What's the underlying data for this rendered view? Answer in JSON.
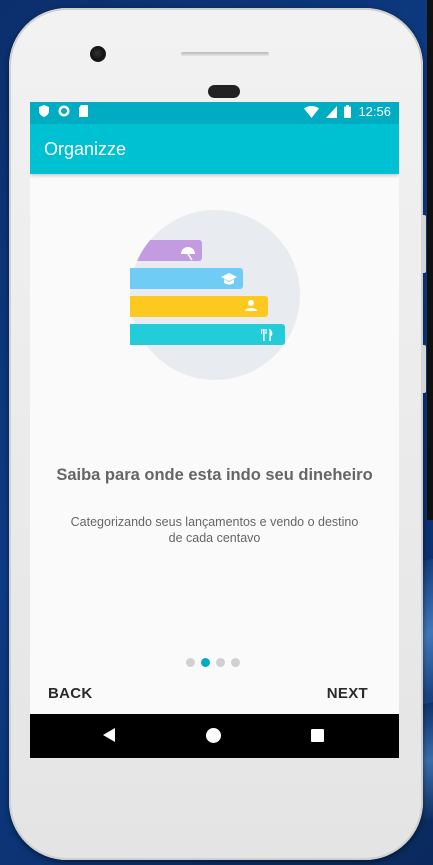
{
  "status_bar": {
    "time": "12:56",
    "icons": [
      "shield-icon",
      "circle-icon",
      "sd-card-icon",
      "wifi-icon",
      "signal-icon",
      "battery-icon"
    ]
  },
  "app_bar": {
    "title": "Organizze"
  },
  "onboarding": {
    "illustration_icons": [
      "umbrella-icon",
      "graduation-cap-icon",
      "person-icon",
      "fork-knife-icon"
    ],
    "colors": {
      "bar_purple": "#c39be0",
      "bar_blue": "#6fcdf5",
      "bar_yellow": "#fcc920",
      "bar_teal": "#22ccd9",
      "circle_bg": "#e8ebf0",
      "accent": "#00acc1"
    },
    "headline": "Saiba para onde esta indo seu dineheiro",
    "subtitle": "Categorizando seus lançamentos e vendo o destino de cada centavo",
    "page_indicator": {
      "total": 4,
      "current": 2
    },
    "back_label": "BACK",
    "next_label": "NEXT"
  },
  "system_nav": {
    "buttons": [
      "back-triangle-icon",
      "home-circle-icon",
      "recents-square-icon"
    ]
  }
}
